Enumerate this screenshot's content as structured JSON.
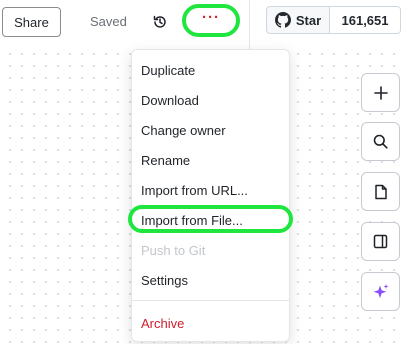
{
  "header": {
    "share_label": "Share",
    "saved_label": "Saved",
    "history_icon": "history-icon",
    "more_label": "···",
    "github": {
      "star_label": "Star",
      "star_count": "161,651",
      "icon": "github-icon"
    }
  },
  "menu": {
    "items": [
      {
        "label": "Duplicate",
        "state": "normal"
      },
      {
        "label": "Download",
        "state": "normal"
      },
      {
        "label": "Change owner",
        "state": "normal"
      },
      {
        "label": "Rename",
        "state": "normal"
      },
      {
        "label": "Import from URL...",
        "state": "normal"
      },
      {
        "label": "Import from File...",
        "state": "highlighted"
      },
      {
        "label": "Push to Git",
        "state": "disabled"
      },
      {
        "label": "Settings",
        "state": "normal"
      }
    ],
    "danger_item": {
      "label": "Archive"
    }
  },
  "toolbar": {
    "buttons": [
      "plus-icon",
      "search-icon",
      "file-icon",
      "panel-icon",
      "sparkle-icon"
    ]
  },
  "colors": {
    "highlight_ring": "#1fe63f",
    "more_dots": "#d1242f",
    "danger": "#cf1f2f",
    "sparkle": "#8a4dfc"
  }
}
